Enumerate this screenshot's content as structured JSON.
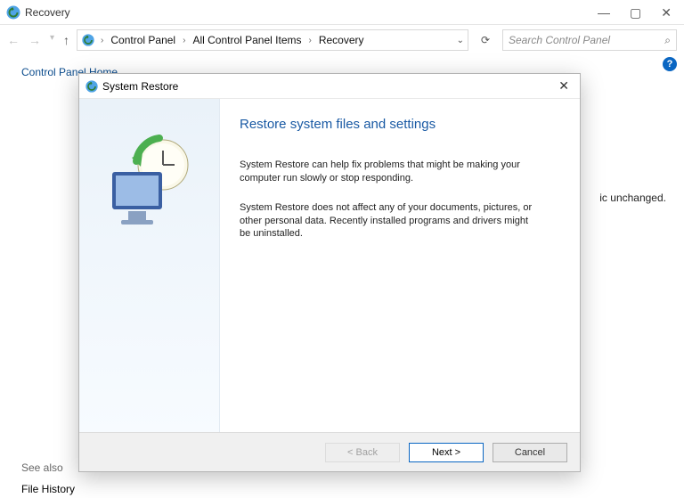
{
  "explorer": {
    "title": "Recovery",
    "breadcrumbs": [
      "Control Panel",
      "All Control Panel Items",
      "Recovery"
    ],
    "search_placeholder": "Search Control Panel"
  },
  "sidebar": {
    "home": "Control Panel Home",
    "see_also": "See also",
    "file_history": "File History"
  },
  "bg": {
    "snippet": "ic unchanged."
  },
  "dialog": {
    "title": "System Restore",
    "heading": "Restore system files and settings",
    "p1": "System Restore can help fix problems that might be making your computer run slowly or stop responding.",
    "p2": "System Restore does not affect any of your documents, pictures, or other personal data. Recently installed programs and drivers might be uninstalled.",
    "buttons": {
      "back": "< Back",
      "next": "Next >",
      "cancel": "Cancel"
    }
  },
  "help_tooltip": "?"
}
